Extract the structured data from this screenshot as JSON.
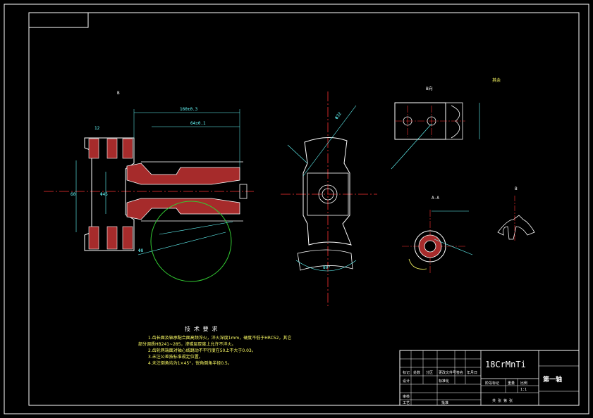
{
  "drawing": {
    "material": "18CrMnTi",
    "part_name": "第一轴",
    "scale_label": "1:1"
  },
  "tech_requirements": {
    "title": "技 术 要 求",
    "lines": [
      "1.齿长面及轴承配合面高频淬火，淬火深度1mm，硬度不低于HRC52，其它",
      "部分调质HB241~285，渗碳层厚度上允许不淬火。",
      "2.齿轮两端面对轴心线跳动不平行度在50上不大于0.03。",
      "3.未注公差按标准规定位置。",
      "4.未注倒角均为1×45°，锐角倒角半径0.5。"
    ]
  },
  "title_block": {
    "row_labels": [
      "标记",
      "处数",
      "分区",
      "更改文件号",
      "签名",
      "年月日"
    ],
    "designer": "设计",
    "check": "审核",
    "process": "工艺",
    "standard": "标准化",
    "approve": "批准",
    "stage_label": "阶段标记",
    "weight": "重量",
    "scale": "比例",
    "sheet": "共  张  第  张"
  },
  "views": {
    "section_a": "A-A",
    "section_b": "B",
    "view_label": "B向",
    "roughness": "其余"
  },
  "dimensions": {
    "d1": "160±0.3",
    "d2": "64±0.1",
    "d3": "Φ32",
    "d4": "Φ45",
    "d5": "12",
    "d6": "60",
    "d7": "80°",
    "d8": "Φ8"
  }
}
